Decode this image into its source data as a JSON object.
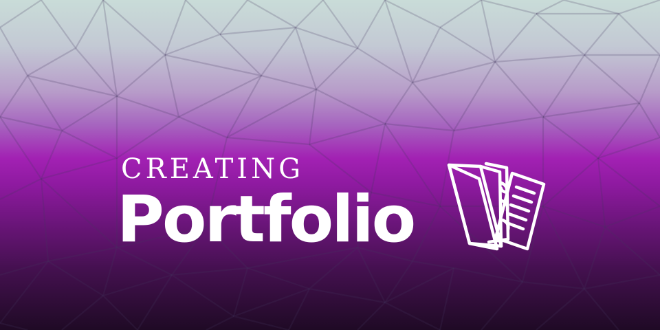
{
  "banner": {
    "subtitle": "CREATING",
    "title": "Portfolio",
    "icon": "folder-documents-icon"
  },
  "colors": {
    "gradient_top": "#c9dcd8",
    "gradient_mid": "#a221b3",
    "gradient_bottom": "#1f0a25",
    "text": "#ffffff"
  }
}
